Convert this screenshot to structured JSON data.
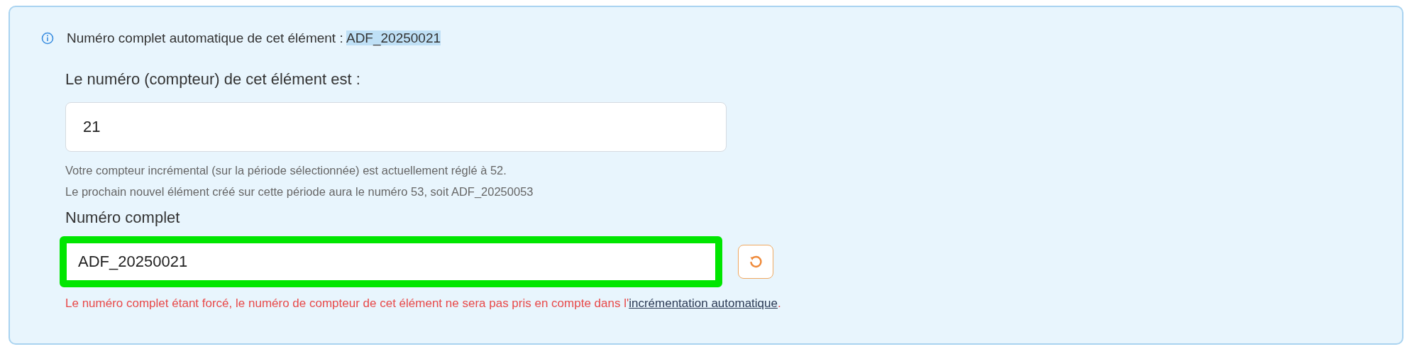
{
  "info": {
    "text": "Numéro complet automatique de cet élément :",
    "value": "ADF_20250021"
  },
  "counter": {
    "label": "Le numéro (compteur) de cet élément est :",
    "value": "21"
  },
  "help": [
    "Votre compteur incrémental (sur la période sélectionnée) est actuellement réglé à 52.",
    "Le prochain nouvel élément créé sur cette période aura le numéro 53, soit ADF_20250053"
  ],
  "full_number": {
    "label": "Numéro complet",
    "value": "ADF_20250021",
    "highlighted": true
  },
  "warning": {
    "text": "Le numéro complet étant forcé, le numéro de compteur de cet élément ne sera pas pris en compte dans l'",
    "link": "incrémentation automatique",
    "end": "."
  }
}
